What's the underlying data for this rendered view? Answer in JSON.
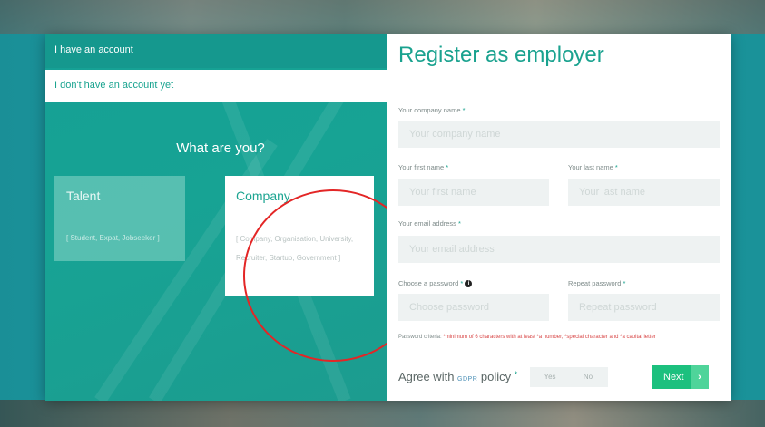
{
  "left": {
    "tab_account": "I have an account",
    "tab_no_account": "I don't have an account yet",
    "question": "What are you?",
    "talent": {
      "title": "Talent",
      "desc": "[ Student, Expat, Jobseeker ]"
    },
    "company": {
      "title": "Company",
      "desc": "[ Company, Organisation, University, Recruiter, Startup, Government ]"
    }
  },
  "form": {
    "title": "Register as employer",
    "company_name": {
      "label": "Your company name",
      "placeholder": "Your company name"
    },
    "first_name": {
      "label": "Your first name",
      "placeholder": "Your first name"
    },
    "last_name": {
      "label": "Your last name",
      "placeholder": "Your last name"
    },
    "email": {
      "label": "Your email address",
      "placeholder": "Your email address"
    },
    "password": {
      "label": "Choose a password",
      "placeholder": "Choose password"
    },
    "repeat_password": {
      "label": "Repeat password",
      "placeholder": "Repeat password"
    },
    "required_mark": "*",
    "criteria_prefix": "Password criteria: ",
    "criteria_text": "*minimum of 6 characters with at least *a number, *special character and *a capital letter",
    "gdpr_prefix": "Agree with",
    "gdpr_word": "GDPR",
    "gdpr_suffix": "policy",
    "yes": "Yes",
    "no": "No",
    "next": "Next",
    "next_arrow": "›",
    "info_glyph": "i"
  },
  "colors": {
    "accent": "#1aa28f",
    "next_button": "#1cc07e",
    "annotation": "#e32626"
  }
}
